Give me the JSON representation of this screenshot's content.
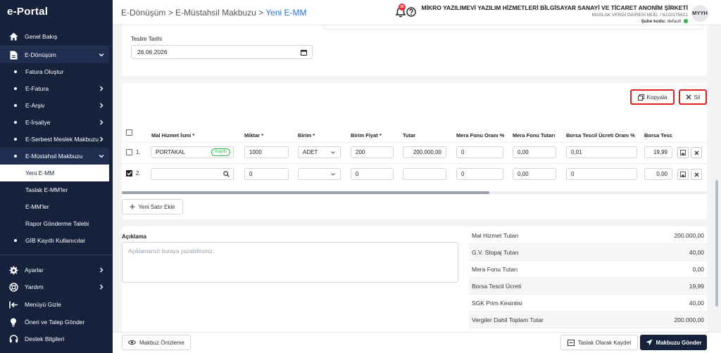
{
  "app": {
    "logo": "e-Portal"
  },
  "sidebar": {
    "items": [
      {
        "label": "Genel Bakış",
        "icon": "home-icon"
      },
      {
        "label": "E-Dönüşüm",
        "icon": "document-icon"
      },
      {
        "label": "Fatura Oluştur"
      },
      {
        "label": "E-Fatura"
      },
      {
        "label": "E-Arşiv"
      },
      {
        "label": "E-İrsaliye"
      },
      {
        "label": "E-Serbest Meslek Makbuzu"
      },
      {
        "label": "E-Müstahsil Makbuzu"
      },
      {
        "label": "Yeni E-MM"
      },
      {
        "label": "Taslak E-MM'ler"
      },
      {
        "label": "E-MM'ler"
      },
      {
        "label": "Rapor Gönderme Talebi"
      },
      {
        "label": "GİB Kayıtlı Kullanıcılar"
      }
    ],
    "bottom": [
      {
        "label": "Ayarlar",
        "icon": "gear-icon"
      },
      {
        "label": "Yardım",
        "icon": "lifebuoy-icon"
      },
      {
        "label": "Menüyü Gizle",
        "icon": "collapse-icon"
      },
      {
        "label": "Öneri ve Talep Gönder",
        "icon": "lightbulb-icon"
      },
      {
        "label": "Destek Bilgileri",
        "icon": "headset-icon"
      }
    ]
  },
  "topbar": {
    "breadcrumb": {
      "part1": "E-Dönüşüm",
      "sep": ">",
      "part2": "E-Müstahsil Makbuzu",
      "current": "Yeni E-MM"
    },
    "notification_count": "30",
    "company_name": "MİKRO YAZILIMEVİ YAZILIM HİZMETLERİ BİLGİSAYAR SANAYİ VE TİCARET ANONİM ŞİRKETİ",
    "tax_office": "MASLAK VERGİ DAİRESİ MÜD. / 6210175621",
    "branch_label": "Şube kodu:",
    "branch_value": "default",
    "avatar_initials": "MYYH"
  },
  "form": {
    "teslim_label": "Teslim Tarihi",
    "teslim_value": "26.06.2026"
  },
  "table": {
    "copy_label": "Kopyala",
    "delete_label": "Sil",
    "headers": [
      "Mal Hizmet İsmi *",
      "Miktar *",
      "Birim *",
      "Birim Fiyat *",
      "Tutar",
      "Mera Fonu Oranı %",
      "Mera Fonu Tutarı",
      "Borsa Tescil Ücreti Oranı %",
      "Borsa Tesc"
    ],
    "rows": [
      {
        "no": "1.",
        "name": "PORTAKAL",
        "badge": "Kayıtlı",
        "miktar": "1000",
        "birim": "ADET",
        "fiyat": "200",
        "tutar": "200.000,00",
        "mera_oran": "0",
        "mera_tutar": "0,00",
        "borsa_oran": "0,01",
        "borsa_tutar": "19,99",
        "checked": false
      },
      {
        "no": "2.",
        "name": "",
        "badge": "",
        "miktar": "0",
        "birim": "",
        "fiyat": "0",
        "tutar": "",
        "mera_oran": "0",
        "mera_tutar": "0,00",
        "borsa_oran": "0",
        "borsa_tutar": "0,00",
        "checked": true
      }
    ],
    "add_row_label": "Yeni Satır Ekle"
  },
  "notes": {
    "label": "Açıklama",
    "placeholder": "Açıklamanızı buraya yazabilirsiniz."
  },
  "summary": [
    {
      "label": "Mal Hizmet Tutarı",
      "value": "200.000,00"
    },
    {
      "label": "G.V. Stopaj Tutarı",
      "value": "40,00"
    },
    {
      "label": "Mera Fonu Tutarı",
      "value": "0,00"
    },
    {
      "label": "Borsa Tescil Ücreti",
      "value": "19,99"
    },
    {
      "label": "SGK Prim Kesintisi",
      "value": "40,00"
    },
    {
      "label": "Vergiler Dahil Toplam Tutar",
      "value": "200.000,00"
    }
  ],
  "footer": {
    "preview_label": "Makbuz Önizleme",
    "draft_label": "Taslak Olarak Kaydet",
    "send_label": "Makbuzu Gönder"
  },
  "colors": {
    "sidebar": "#16213b",
    "accent": "#2d6fd1",
    "highlight": "#e02020",
    "success": "#2fb344"
  }
}
